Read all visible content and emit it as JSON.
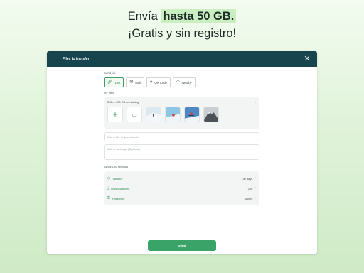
{
  "promo": {
    "line1_prefix": "Envía",
    "line1_highlight": "hasta 50 GB.",
    "line2": "¡Gratis y sin registro!"
  },
  "window": {
    "title": "Files to transfer"
  },
  "send_via": {
    "label": "Send via",
    "options": [
      {
        "label": "Link",
        "icon": "link-icon",
        "active": true
      },
      {
        "label": "Mail",
        "icon": "mail-icon",
        "active": false
      },
      {
        "label": "QR Code",
        "icon": "qr-icon",
        "active": false
      },
      {
        "label": "Nearby",
        "icon": "wifi-icon",
        "active": false
      }
    ]
  },
  "my_files": {
    "label": "My files",
    "count_text": "5 files",
    "remaining_text": "50 GB remaining",
    "add_icon": "plus-icon",
    "folder_icon": "folder-icon"
  },
  "title_field": {
    "placeholder": "Add a title to your transfer"
  },
  "message_field": {
    "placeholder": "Add a message (Optional)"
  },
  "advanced": {
    "label": "Advanced settings",
    "rows": [
      {
        "label": "Valid for",
        "value": "30 days",
        "icon": "clock-icon"
      },
      {
        "label": "Download limit",
        "value": "250",
        "icon": "download-icon"
      },
      {
        "label": "Password",
        "value": "Added",
        "icon": "key-icon"
      }
    ]
  },
  "send_button": {
    "label": "Send"
  },
  "colors": {
    "accent": "#3aa368",
    "titlebar": "#18454d",
    "highlight": "#c9efc0"
  }
}
